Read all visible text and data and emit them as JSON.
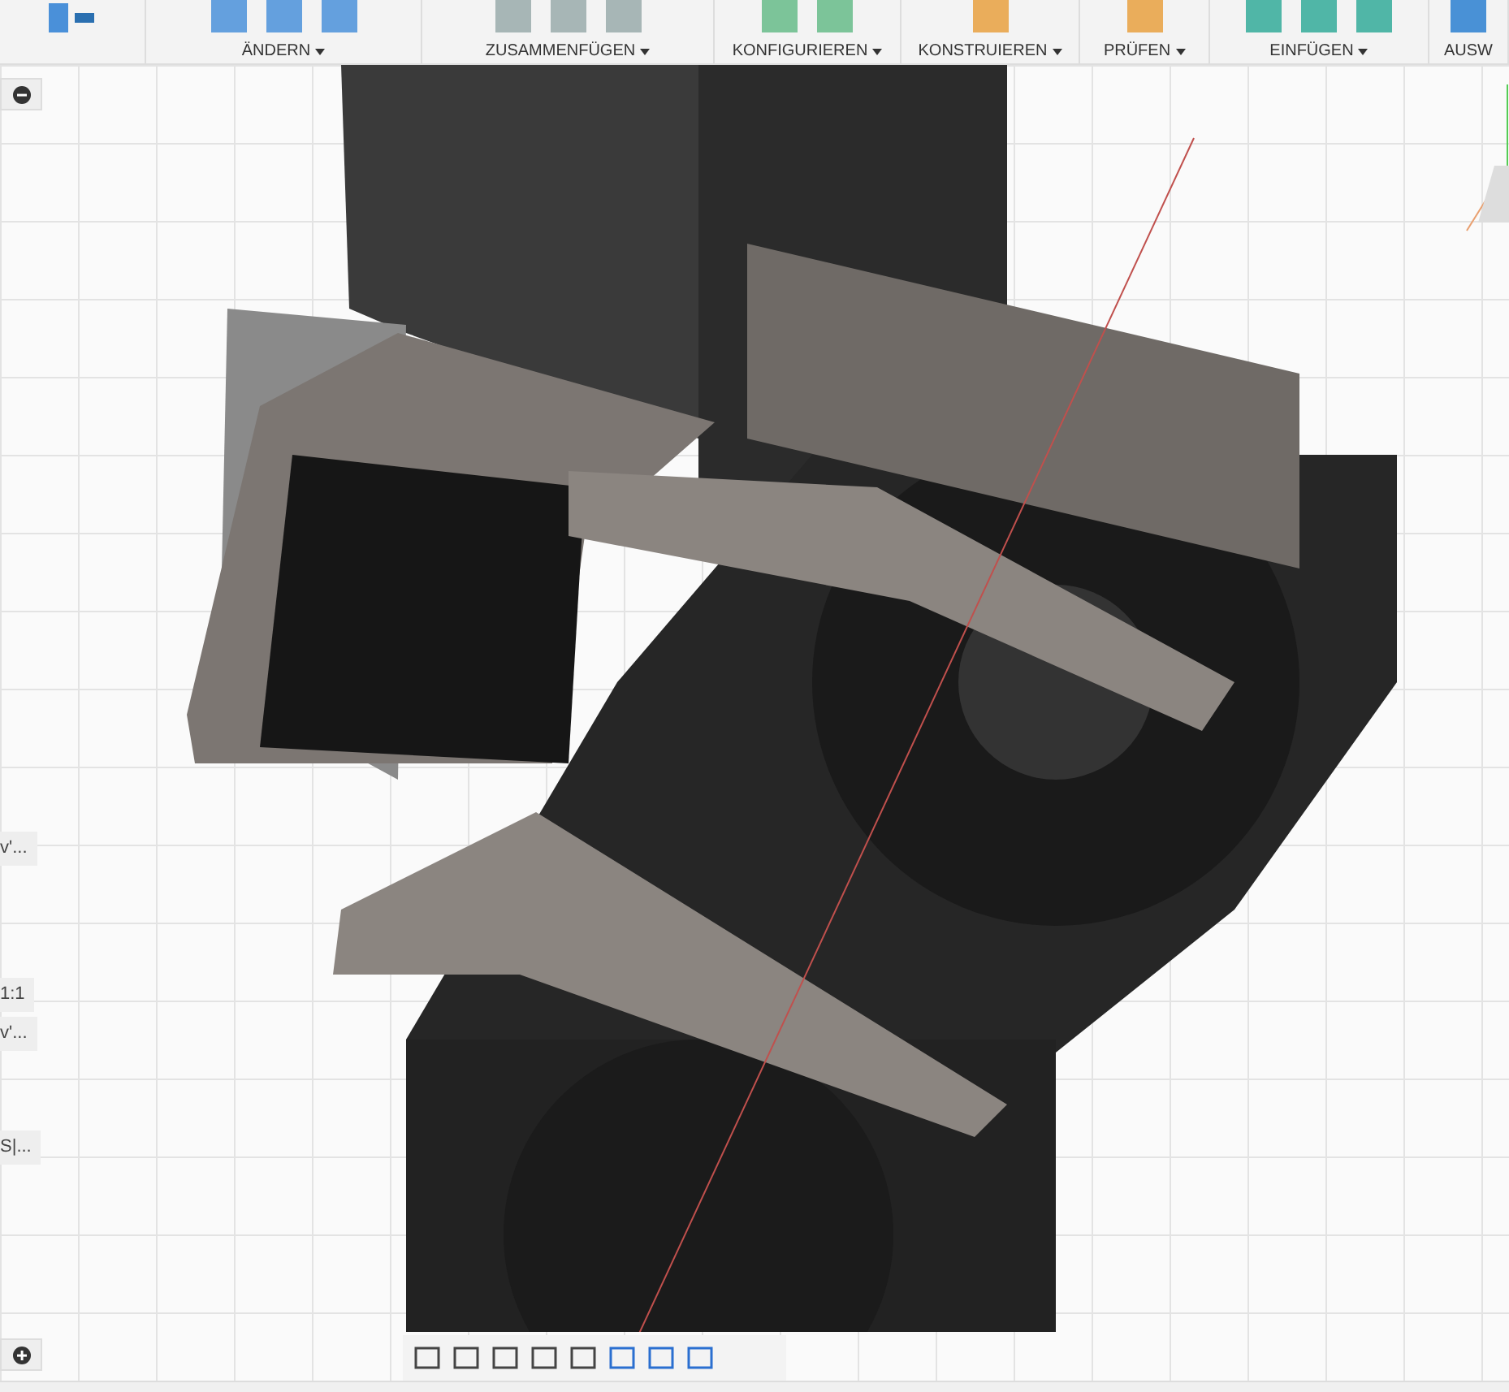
{
  "toolbar": {
    "groups": [
      {
        "label": "ÄNDERN"
      },
      {
        "label": "ZUSAMMENFÜGEN"
      },
      {
        "label": "KONFIGURIEREN"
      },
      {
        "label": "KONSTRUIEREN"
      },
      {
        "label": "PRÜFEN"
      },
      {
        "label": "EINFÜGEN"
      },
      {
        "label": "AUSW"
      }
    ]
  },
  "side_panels": [
    {
      "label": "v'..."
    },
    {
      "label": "1:1"
    },
    {
      "label": "v'..."
    },
    {
      "label": "S|..."
    }
  ]
}
